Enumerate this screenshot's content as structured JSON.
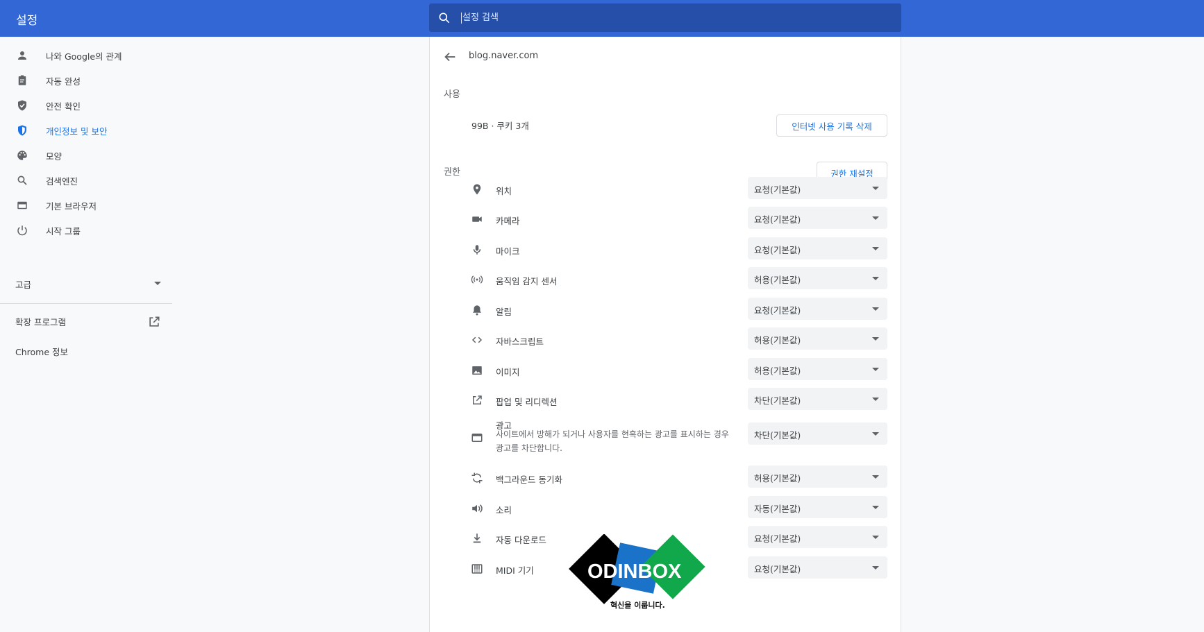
{
  "header": {
    "title": "설정",
    "search_placeholder": "설정 검색"
  },
  "sidebar": {
    "items": [
      {
        "label": "나와 Google의 관계",
        "icon": "person-icon"
      },
      {
        "label": "자동 완성",
        "icon": "clipboard-icon"
      },
      {
        "label": "안전 확인",
        "icon": "shield-check-icon"
      },
      {
        "label": "개인정보 및 보안",
        "icon": "shield-icon",
        "active": true
      },
      {
        "label": "모양",
        "icon": "palette-icon"
      },
      {
        "label": "검색엔진",
        "icon": "search-icon"
      },
      {
        "label": "기본 브라우저",
        "icon": "browser-icon"
      },
      {
        "label": "시작 그룹",
        "icon": "power-icon"
      }
    ],
    "advanced_label": "고급",
    "extensions_label": "확장 프로그램",
    "about_label": "Chrome 정보"
  },
  "site": {
    "name": "blog.naver.com",
    "usage_heading": "사용",
    "usage_value": "99B · 쿠키 3개",
    "clear_button": "인터넷 사용 기록 삭제",
    "permissions_heading": "권한",
    "reset_button": "권한 재설정"
  },
  "permissions": [
    {
      "label": "위치",
      "value": "요청(기본값)",
      "icon": "location-pin-icon"
    },
    {
      "label": "카메라",
      "value": "요청(기본값)",
      "icon": "camera-icon"
    },
    {
      "label": "마이크",
      "value": "요청(기본값)",
      "icon": "microphone-icon"
    },
    {
      "label": "움직임 감지 센서",
      "value": "허용(기본값)",
      "icon": "motion-sensor-icon"
    },
    {
      "label": "알림",
      "value": "요청(기본값)",
      "icon": "bell-icon"
    },
    {
      "label": "자바스크립트",
      "value": "허용(기본값)",
      "icon": "code-icon"
    },
    {
      "label": "이미지",
      "value": "허용(기본값)",
      "icon": "image-icon"
    },
    {
      "label": "팝업 및 리디렉션",
      "value": "차단(기본값)",
      "icon": "open-external-icon"
    },
    {
      "label": "광고",
      "description": "사이트에서 방해가 되거나 사용자를 현혹하는 광고를 표시하는 경우 광고를 차단합니다.",
      "value": "차단(기본값)",
      "icon": "ad-window-icon"
    },
    {
      "label": "백그라운드 동기화",
      "value": "허용(기본값)",
      "icon": "sync-icon"
    },
    {
      "label": "소리",
      "value": "자동(기본값)",
      "icon": "speaker-icon"
    },
    {
      "label": "자동 다운로드",
      "value": "요청(기본값)",
      "icon": "download-icon"
    },
    {
      "label": "MIDI 기기",
      "value": "요청(기본값)",
      "icon": "piano-icon"
    }
  ],
  "watermark": {
    "brand": "ODINBOX",
    "tagline": "혁신을 이룹니다."
  }
}
